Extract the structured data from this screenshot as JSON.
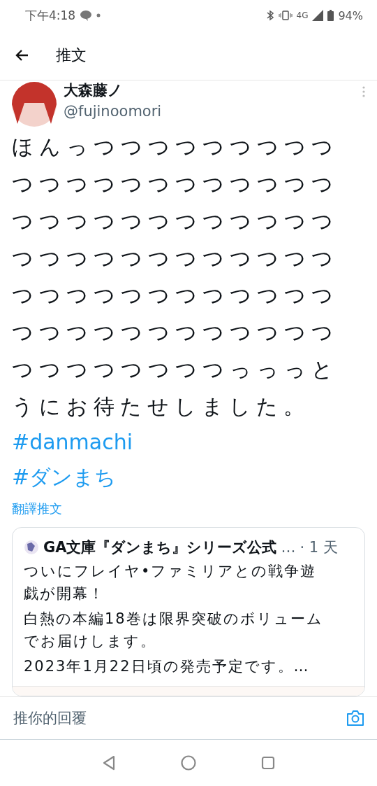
{
  "status_bar": {
    "time": "下午4:18",
    "network": "4G",
    "battery": "94%"
  },
  "header": {
    "title": "推文"
  },
  "tweet": {
    "author": "大森藤ノ",
    "handle": "@fujinoomori",
    "text": "ほんっつつつつつつつつつつつつつつつつつつつつつつつつつつつつつつつつつつつつつつつつつつつつつつつつつつつつつつつつつつつつつつつつつつつつつつつつつつつつつっっっとうにお待たせしました。",
    "hashtags": [
      "#danmachi",
      "#ダンまち"
    ],
    "translate": "翻譯推文",
    "quote": {
      "author": "GA文庫『ダンまち』シリーズ公式",
      "ellipsis": "…",
      "time": "· 1 天",
      "lines": [
        "ついにフレイヤ•ファミリアとの戦争遊戯が開幕！",
        "白熱の本編18巻は限界突破のボリュームでお届けします。",
        "2023年1月22日頃の発売予定です。…"
      ]
    }
  },
  "reply": {
    "placeholder": "推你的回覆"
  }
}
